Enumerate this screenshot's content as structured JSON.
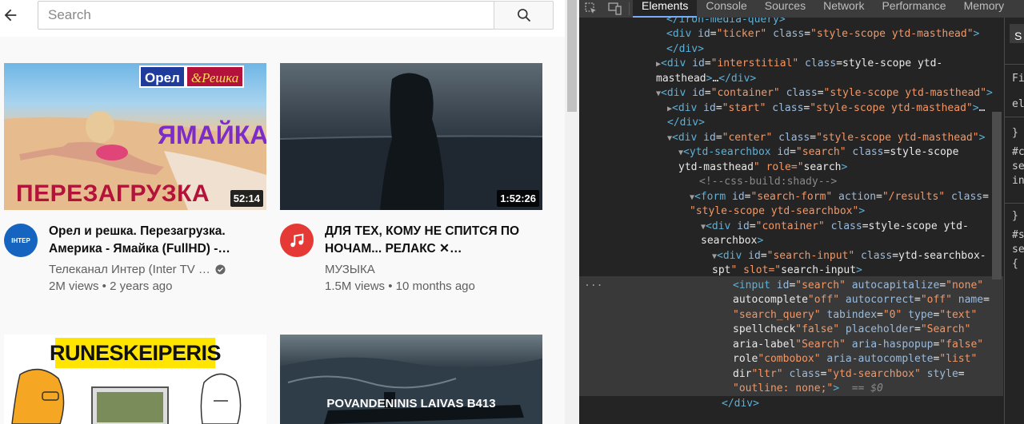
{
  "search": {
    "placeholder": "Search"
  },
  "videos": [
    {
      "title": "Орел и решка. Перезагрузка. Америка - Ямайка (FullHD) -…",
      "channel": "Телеканал Интер (Inter TV …",
      "verified": true,
      "views": "2M views",
      "age": "2 years ago",
      "duration": "52:14",
      "avatar_text": "ІНТЕР",
      "thumb_logo_a": "Орел",
      "thumb_logo_b": "&Решка",
      "thumb_word": "ЯМАЙКА",
      "thumb_caption": "ПЕРЕЗАГРУЗКА"
    },
    {
      "title": "ДЛЯ ТЕХ, КОМУ НЕ СПИТСЯ ПО НОЧАМ... РЕЛАКС ✕…",
      "channel": "МУЗЫКА",
      "verified": false,
      "views": "1.5M views",
      "age": "10 months ago",
      "duration": "1:52:26"
    },
    {
      "thumb_text": "RUNESKEIPERIS"
    },
    {
      "thumb_text": "POVANDENINIS LAIVAS B413"
    }
  ],
  "devtools": {
    "tabs": [
      "Elements",
      "Console",
      "Sources",
      "Network",
      "Performance",
      "Memory"
    ],
    "active_tab": "Elements",
    "dots": "...",
    "lines": [
      "</iron-media-query>",
      "<div id=\"ticker\" class=\"style-scope ytd-masthead\">",
      "</div>",
      "<div id=\"interstitial\" class=\"style-scope ytd-",
      "masthead\">…</div>",
      "<div id=\"container\" class=\"style-scope ytd-masthead\">",
      "<div id=\"start\" class=\"style-scope ytd-masthead\">…",
      "</div>",
      "<div id=\"center\" class=\"style-scope ytd-masthead\">",
      "<ytd-searchbox id=\"search\" class=\"style-scope",
      "ytd-masthead\" role=\"search\">",
      "<!--css-build:shady-->",
      "<form id=\"search-form\" action=\"/results\" class=",
      "\"style-scope ytd-searchbox\">",
      "<div id=\"container\" class=\"style-scope ytd-",
      "searchbox\">",
      "<div id=\"search-input\" class=\"ytd-searchbox-",
      "spt\" slot=\"search-input\">",
      "<input id=\"search\" autocapitalize=\"none\"",
      "autocomplete=\"off\" autocorrect=\"off\" name=",
      "\"search_query\" tabindex=\"0\" type=\"text\"",
      "spellcheck=\"false\" placeholder=\"Search\"",
      "aria-label=\"Search\" aria-haspopup=\"false\"",
      "role=\"combobox\" aria-autocomplete=\"list\"",
      "dir=\"ltr\" class=\"ytd-searchbox\" style=",
      "\"outline: none;\"> == $0",
      "</div>"
    ],
    "styles_lines": [
      "S",
      "Filt",
      "ele",
      "}",
      "#co",
      "sea",
      "inp",
      "}",
      "#se",
      "sea",
      "{"
    ]
  },
  "colors": {
    "dt_tag": "#5db0d7",
    "dt_attr": "#9bbbdc",
    "dt_value": "#f29766",
    "dt_active_underline": "#7cacf8",
    "inter_blue": "#1565c0",
    "music_red": "#e53935"
  }
}
